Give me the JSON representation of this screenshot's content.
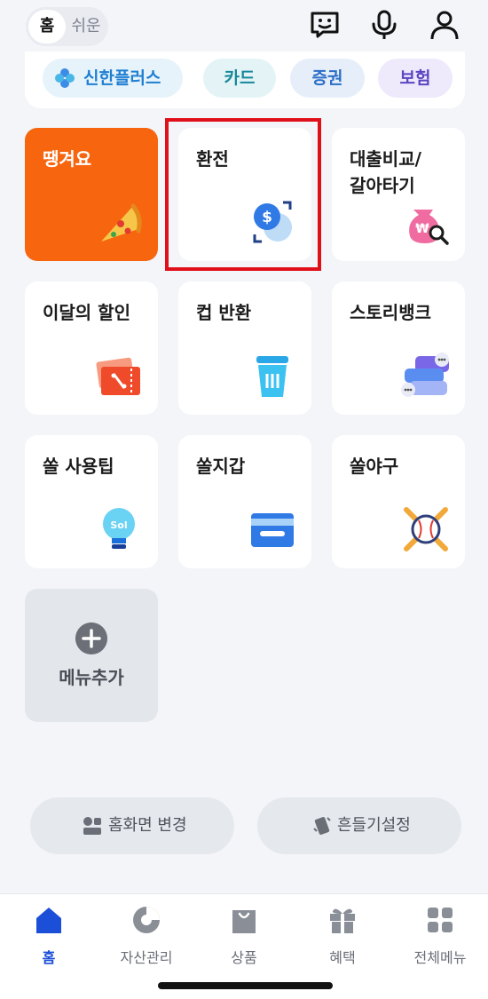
{
  "header": {
    "mode_home": "홈",
    "mode_easy": "쉬운",
    "icons": [
      "chatbot-icon",
      "microphone-icon",
      "profile-icon"
    ]
  },
  "brands": [
    {
      "label": "신한플러스",
      "icon": "plus-flower-icon",
      "color": "#1f7fd1"
    },
    {
      "label": "카드",
      "color": "#17889a"
    },
    {
      "label": "증권",
      "color": "#2c6ec8"
    },
    {
      "label": "보험",
      "color": "#5a46c2"
    }
  ],
  "tiles": [
    {
      "label": "땡겨요",
      "icon": "pizza-icon",
      "accent": "#f7650f"
    },
    {
      "label": "환전",
      "icon": "currency-exchange-icon",
      "highlighted": true
    },
    {
      "label": "대출비교/\n갈아타기",
      "icon": "money-bag-search-icon"
    },
    {
      "label": "이달의 할인",
      "icon": "coupon-icon"
    },
    {
      "label": "컵 반환",
      "icon": "cup-icon"
    },
    {
      "label": "스토리뱅크",
      "icon": "chat-bubbles-icon"
    },
    {
      "label": "쏠 사용팁",
      "icon": "lightbulb-icon"
    },
    {
      "label": "쏠지갑",
      "icon": "wallet-icon"
    },
    {
      "label": "쏠야구",
      "icon": "baseball-icon"
    }
  ],
  "add_tile": {
    "label": "메뉴추가",
    "icon": "plus-circle-icon"
  },
  "actions": [
    {
      "label": "홈화면 변경",
      "icon": "layout-icon"
    },
    {
      "label": "흔들기설정",
      "icon": "shake-phone-icon"
    }
  ],
  "nav": [
    {
      "label": "홈",
      "icon": "home-icon",
      "active": true
    },
    {
      "label": "자산관리",
      "icon": "pie-chart-icon"
    },
    {
      "label": "상품",
      "icon": "shopping-bag-icon"
    },
    {
      "label": "혜택",
      "icon": "gift-icon"
    },
    {
      "label": "전체메뉴",
      "icon": "grid-menu-icon"
    }
  ],
  "colors": {
    "accent": "#1c4fd8",
    "highlight_border": "#e0101b",
    "background": "#f3f5f9"
  }
}
